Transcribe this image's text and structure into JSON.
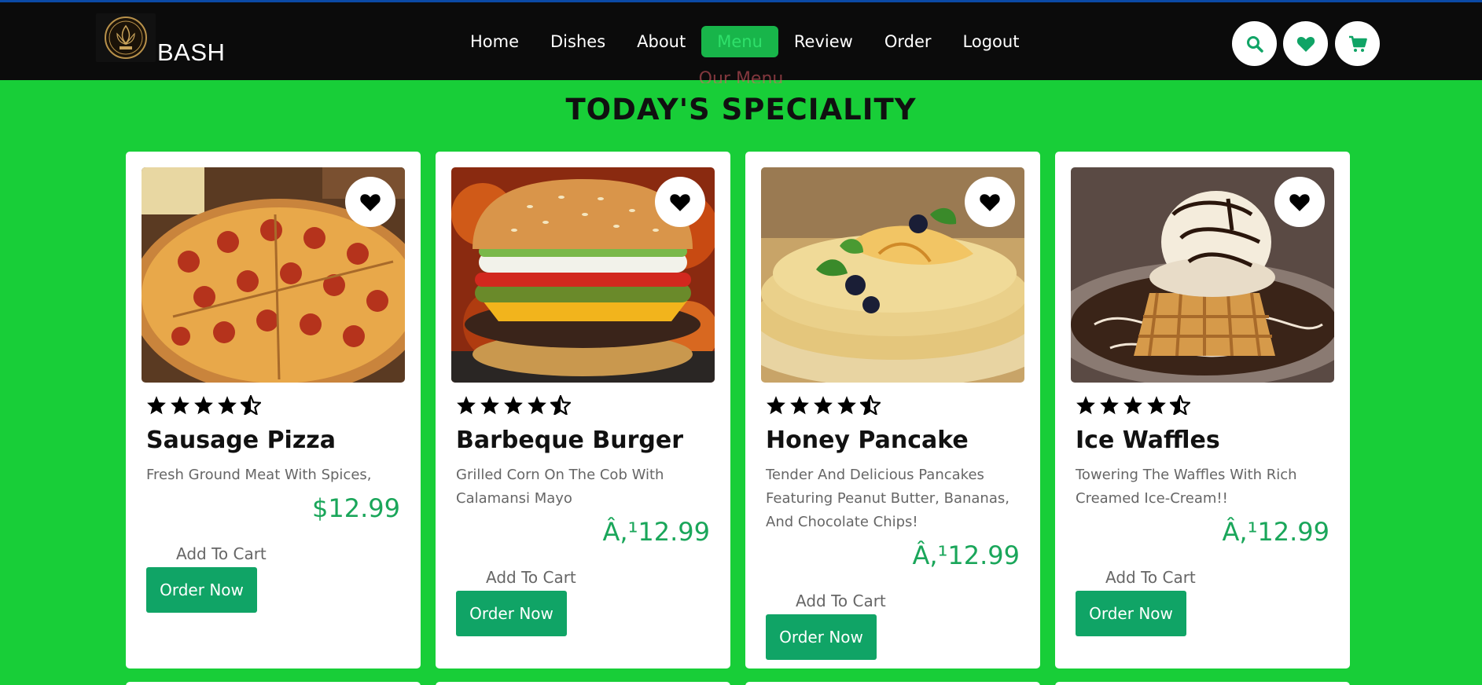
{
  "header": {
    "brand": "BASH",
    "nav": [
      "Home",
      "Dishes",
      "About",
      "Menu",
      "Review",
      "Order",
      "Logout"
    ],
    "active_nav": "Menu",
    "icons": [
      "search-icon",
      "heart-icon",
      "cart-icon"
    ]
  },
  "section": {
    "subtitle": "Our Menu",
    "title": "TODAY'S SPECIALITY"
  },
  "items": [
    {
      "name": "Sausage Pizza",
      "description": "Fresh Ground Meat With Spices,",
      "price": "$12.99",
      "rating": 4.5,
      "add_to_cart": "Add To Cart",
      "order": "Order Now"
    },
    {
      "name": "Barbeque Burger",
      "description": "Grilled Corn On The Cob With Calamansi Mayo",
      "price": "Â,¹12.99",
      "rating": 4.5,
      "add_to_cart": "Add To Cart",
      "order": "Order Now"
    },
    {
      "name": "Honey Pancake",
      "description": "Tender And Delicious Pancakes Featuring Peanut Butter, Bananas, And Chocolate Chips!",
      "price": "Â,¹12.99",
      "rating": 4.5,
      "add_to_cart": "Add To Cart",
      "order": "Order Now"
    },
    {
      "name": "Ice Waffles",
      "description": "Towering The Waffles With Rich Creamed Ice-Cream!!",
      "price": "Â,¹12.99",
      "rating": 4.5,
      "add_to_cart": "Add To Cart",
      "order": "Order Now"
    }
  ],
  "colors": {
    "page_bg": "#18ce38",
    "navbar_bg": "#0b0b0b",
    "accent": "#10a466",
    "price": "#1aa65a"
  }
}
